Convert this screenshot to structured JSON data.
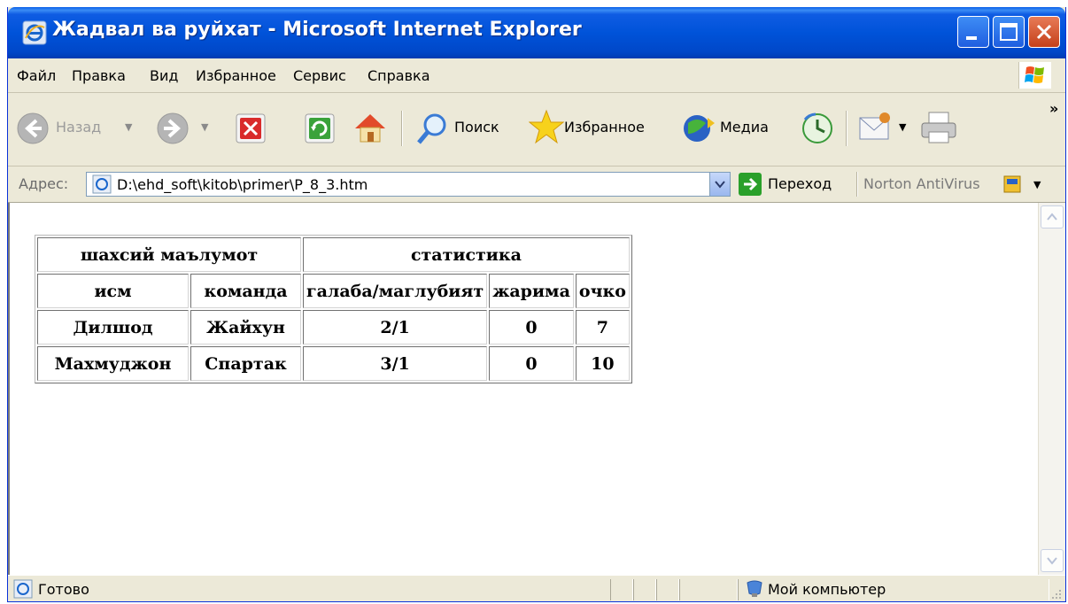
{
  "window": {
    "title": "Жадвал ва руйхат - Microsoft Internet Explorer"
  },
  "menu": {
    "items": [
      "Файл",
      "Правка",
      "Вид",
      "Избранное",
      "Сервис",
      "Справка"
    ]
  },
  "toolbar": {
    "back_label": "Назад",
    "search_label": "Поиск",
    "favorites_label": "Избранное",
    "media_label": "Медиа",
    "more_label": "»"
  },
  "address": {
    "label": "Адрес:",
    "value": "D:\\ehd_soft\\kitob\\primer\\P_8_3.htm",
    "go_label": "Переход",
    "norton_label": "Norton AntiVirus"
  },
  "table": {
    "group_headers": [
      "шахсий маълумот",
      "статистика"
    ],
    "column_headers": [
      "исм",
      "команда",
      "галаба/маглубият",
      "жарима",
      "очко"
    ],
    "rows": [
      [
        "Дилшод",
        "Жайхун",
        "2/1",
        "0",
        "7"
      ],
      [
        "Махмуджон",
        "Спартак",
        "3/1",
        "0",
        "10"
      ]
    ]
  },
  "status": {
    "text": "Готово",
    "zone": "Мой компьютер"
  },
  "colors": {
    "titlebar": "#0053d9",
    "chrome": "#ece9d8",
    "close_button": "#c4401a"
  }
}
